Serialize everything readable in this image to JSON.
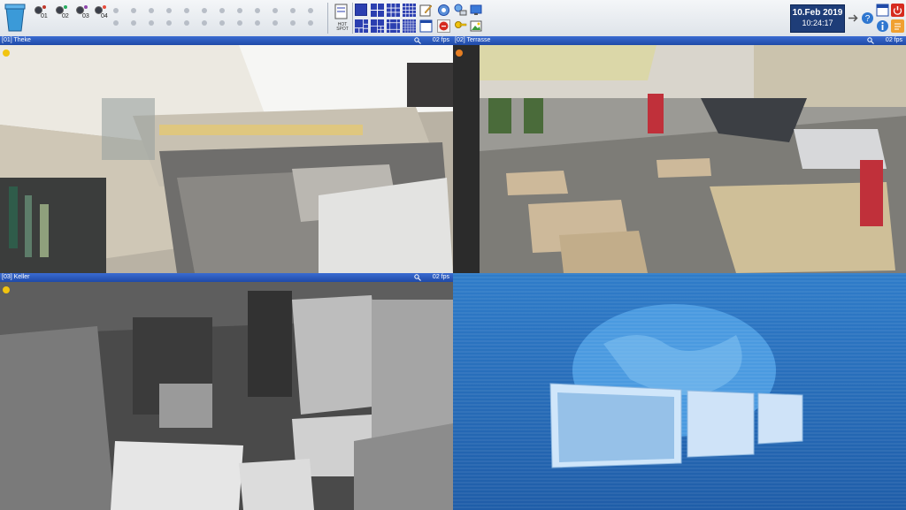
{
  "toolbar": {
    "cameras": [
      {
        "label": "01",
        "dot_color": "#c0392b"
      },
      {
        "label": "02",
        "dot_color": "#27ae60"
      },
      {
        "label": "03",
        "dot_color": "#8e44ad"
      },
      {
        "label": "04",
        "dot_color": "#e74c3c"
      }
    ],
    "hotspot_label": "HOT SPOT",
    "icons": [
      "trash-icon",
      "hotspot-icon",
      "layout-1x1-icon",
      "layout-2x2-icon",
      "layout-3x3-icon",
      "layout-4x4-icon",
      "edit-icon",
      "settings-icon",
      "network-icon",
      "window-icon",
      "record-icon",
      "key-icon",
      "image-icon",
      "exit-icon",
      "help-icon",
      "info-icon",
      "power-icon",
      "notes-icon"
    ]
  },
  "clock": {
    "date": "10.Feb 2019",
    "time": "10:24:17"
  },
  "tiles": [
    {
      "title": "[01] Theke",
      "fps": "02 fps",
      "status_color": "#f1c40f"
    },
    {
      "title": "[02] Terrasse",
      "fps": "02 fps",
      "status_color": "#e67e22"
    },
    {
      "title": "[03] Keller",
      "fps": "02 fps",
      "status_color": "#f1c40f"
    }
  ],
  "colors": {
    "toolbar_bg": "#e6eaef",
    "tile_bar": "#2a5ac0",
    "accent": "#1e3d78"
  }
}
